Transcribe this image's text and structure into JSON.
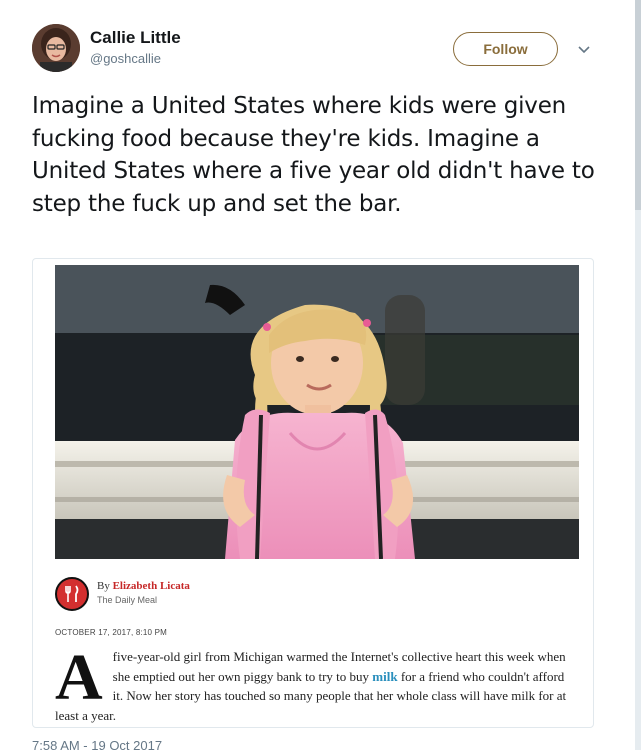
{
  "user": {
    "display_name": "Callie Little",
    "handle": "@goshcallie",
    "follow_label": "Follow"
  },
  "tweet": {
    "text": "Imagine a United States where kids were given fucking food because they're kids. Imagine a United States where a five year old didn't have to step the fuck up and set the bar.",
    "timestamp": "7:58 AM - 19 Oct 2017"
  },
  "article": {
    "by": "By",
    "author": "Elizabeth Licata",
    "publication": "The Daily Meal",
    "date": "OCTOBER 17, 2017, 8:10 PM",
    "drop_cap": "A",
    "body_before": "five-year-old girl from Michigan warmed the Internet's collective heart this week when she emptied out her own piggy bank to try to buy ",
    "body_link": "milk",
    "body_after": " for a friend who couldn't afford it. Now her story has touched so many people that her whole class will have milk for at least a year."
  },
  "icons": {
    "caret": "chevron-down-icon",
    "publication_logo": "fork-knife-icon"
  },
  "colors": {
    "follow_border": "#8a6d3b",
    "author_red": "#c62828",
    "link_blue": "#2a8fbd",
    "shirt_pink": "#f2a1c4"
  }
}
